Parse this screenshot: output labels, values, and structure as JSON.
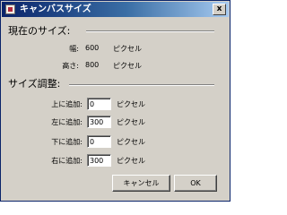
{
  "window": {
    "title": "キャンバスサイズ",
    "close_glyph": "x"
  },
  "current_size": {
    "heading": "現在のサイズ:",
    "width_label": "幅:",
    "width_value": "600",
    "width_unit": "ピクセル",
    "height_label": "高さ:",
    "height_value": "800",
    "height_unit": "ピクセル"
  },
  "adjust": {
    "heading": "サイズ調整:",
    "rows": [
      {
        "label": "上に追加:",
        "value": "0",
        "unit": "ピクセル"
      },
      {
        "label": "左に追加:",
        "value": "300",
        "unit": "ピクセル"
      },
      {
        "label": "下に追加:",
        "value": "0",
        "unit": "ピクセル"
      },
      {
        "label": "右に追加:",
        "value": "300",
        "unit": "ピクセル"
      }
    ]
  },
  "buttons": {
    "cancel": "キャンセル",
    "ok": "OK"
  },
  "colors": {
    "dialog_bg": "#d4d0c8",
    "title_start": "#0a246a",
    "title_end": "#a6caf0"
  },
  "icons": {
    "app": "canvas-app-icon",
    "close": "close-icon"
  }
}
